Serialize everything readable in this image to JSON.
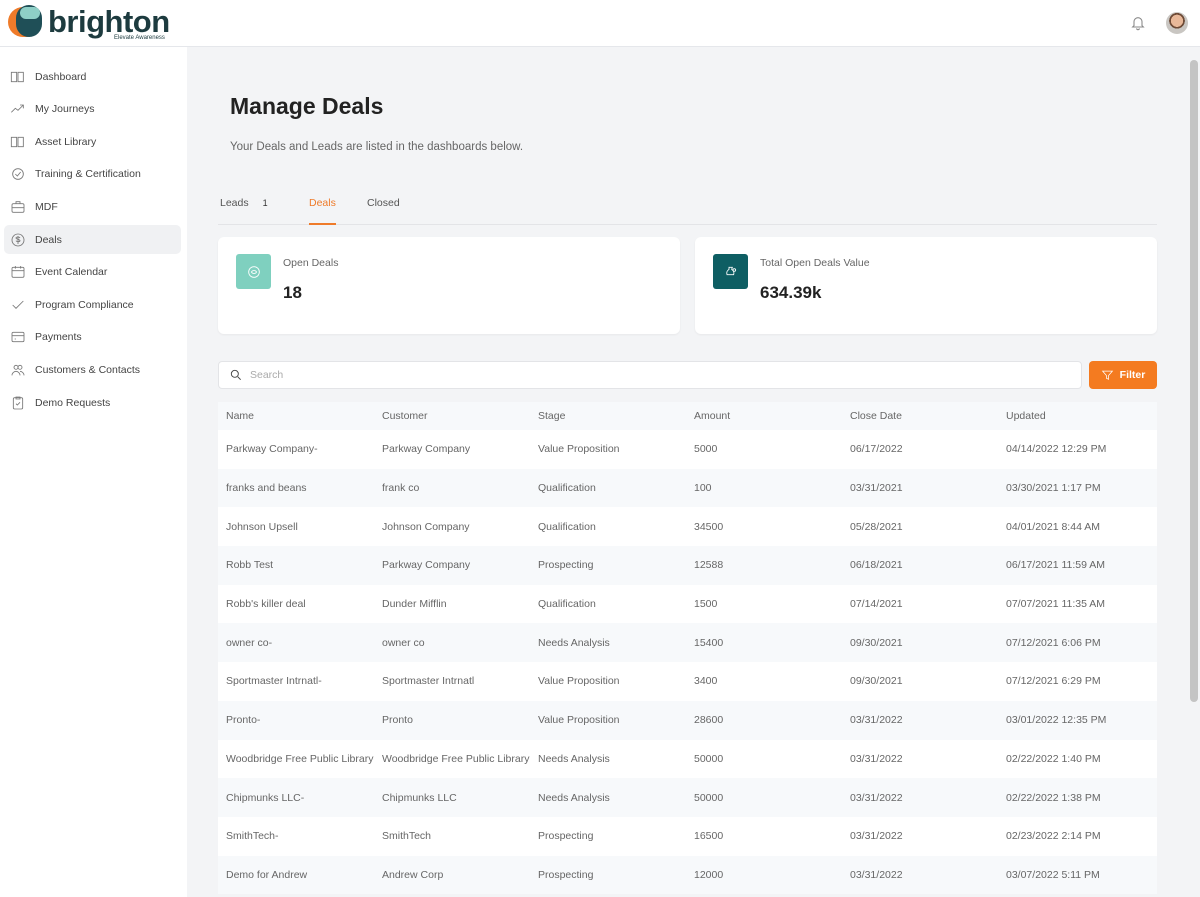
{
  "brand": {
    "name": "brighton",
    "tagline": "Elevate Awareness"
  },
  "sidebar": {
    "items": [
      {
        "label": "Dashboard",
        "icon": "book-icon"
      },
      {
        "label": "My Journeys",
        "icon": "trending-up-icon"
      },
      {
        "label": "Asset Library",
        "icon": "book-icon"
      },
      {
        "label": "Training & Certification",
        "icon": "badge-check-icon"
      },
      {
        "label": "MDF",
        "icon": "briefcase-icon"
      },
      {
        "label": "Deals",
        "icon": "dollar-circle-icon",
        "active": true
      },
      {
        "label": "Event Calendar",
        "icon": "calendar-icon"
      },
      {
        "label": "Program Compliance",
        "icon": "check-icon"
      },
      {
        "label": "Payments",
        "icon": "credit-card-icon"
      },
      {
        "label": "Customers & Contacts",
        "icon": "users-icon"
      },
      {
        "label": "Demo Requests",
        "icon": "clipboard-check-icon"
      }
    ]
  },
  "page": {
    "title": "Manage Deals",
    "subtitle": "Your Deals and Leads are listed in the dashboards below."
  },
  "tabs": [
    {
      "label": "Leads",
      "count": "1"
    },
    {
      "label": "Deals",
      "active": true
    },
    {
      "label": "Closed"
    }
  ],
  "cards": [
    {
      "label": "Open Deals",
      "value": "18",
      "color": "#7fd0bf"
    },
    {
      "label": "Total Open Deals Value",
      "value": "634.39k",
      "color": "#0e5e63"
    }
  ],
  "search": {
    "placeholder": "Search",
    "value": ""
  },
  "filter_label": "Filter",
  "accent": "#f47b20",
  "table": {
    "columns": [
      "Name",
      "Customer",
      "Stage",
      "Amount",
      "Close Date",
      "Updated"
    ],
    "rows": [
      [
        "Parkway Company-",
        "Parkway Company",
        "Value Proposition",
        "5000",
        "06/17/2022",
        "04/14/2022 12:29 PM"
      ],
      [
        "franks and beans",
        "frank co",
        "Qualification",
        "100",
        "03/31/2021",
        "03/30/2021 1:17 PM"
      ],
      [
        "Johnson Upsell",
        "Johnson Company",
        "Qualification",
        "34500",
        "05/28/2021",
        "04/01/2021 8:44 AM"
      ],
      [
        "Robb Test",
        "Parkway Company",
        "Prospecting",
        "12588",
        "06/18/2021",
        "06/17/2021 11:59 AM"
      ],
      [
        "Robb's killer deal",
        "Dunder Mifflin",
        "Qualification",
        "1500",
        "07/14/2021",
        "07/07/2021 11:35 AM"
      ],
      [
        "owner co-",
        "owner co",
        "Needs Analysis",
        "15400",
        "09/30/2021",
        "07/12/2021 6:06 PM"
      ],
      [
        "Sportmaster Intrnatl-",
        "Sportmaster Intrnatl",
        "Value Proposition",
        "3400",
        "09/30/2021",
        "07/12/2021 6:29 PM"
      ],
      [
        "Pronto-",
        "Pronto",
        "Value Proposition",
        "28600",
        "03/31/2022",
        "03/01/2022 12:35 PM"
      ],
      [
        "Woodbridge Free Public Library-",
        "Woodbridge Free Public Library",
        "Needs Analysis",
        "50000",
        "03/31/2022",
        "02/22/2022 1:40 PM"
      ],
      [
        "Chipmunks LLC-",
        "Chipmunks LLC",
        "Needs Analysis",
        "50000",
        "03/31/2022",
        "02/22/2022 1:38 PM"
      ],
      [
        "SmithTech-",
        "SmithTech",
        "Prospecting",
        "16500",
        "03/31/2022",
        "02/23/2022 2:14 PM"
      ],
      [
        "Demo for Andrew",
        "Andrew Corp",
        "Prospecting",
        "12000",
        "03/31/2022",
        "03/07/2022 5:11 PM"
      ]
    ]
  }
}
